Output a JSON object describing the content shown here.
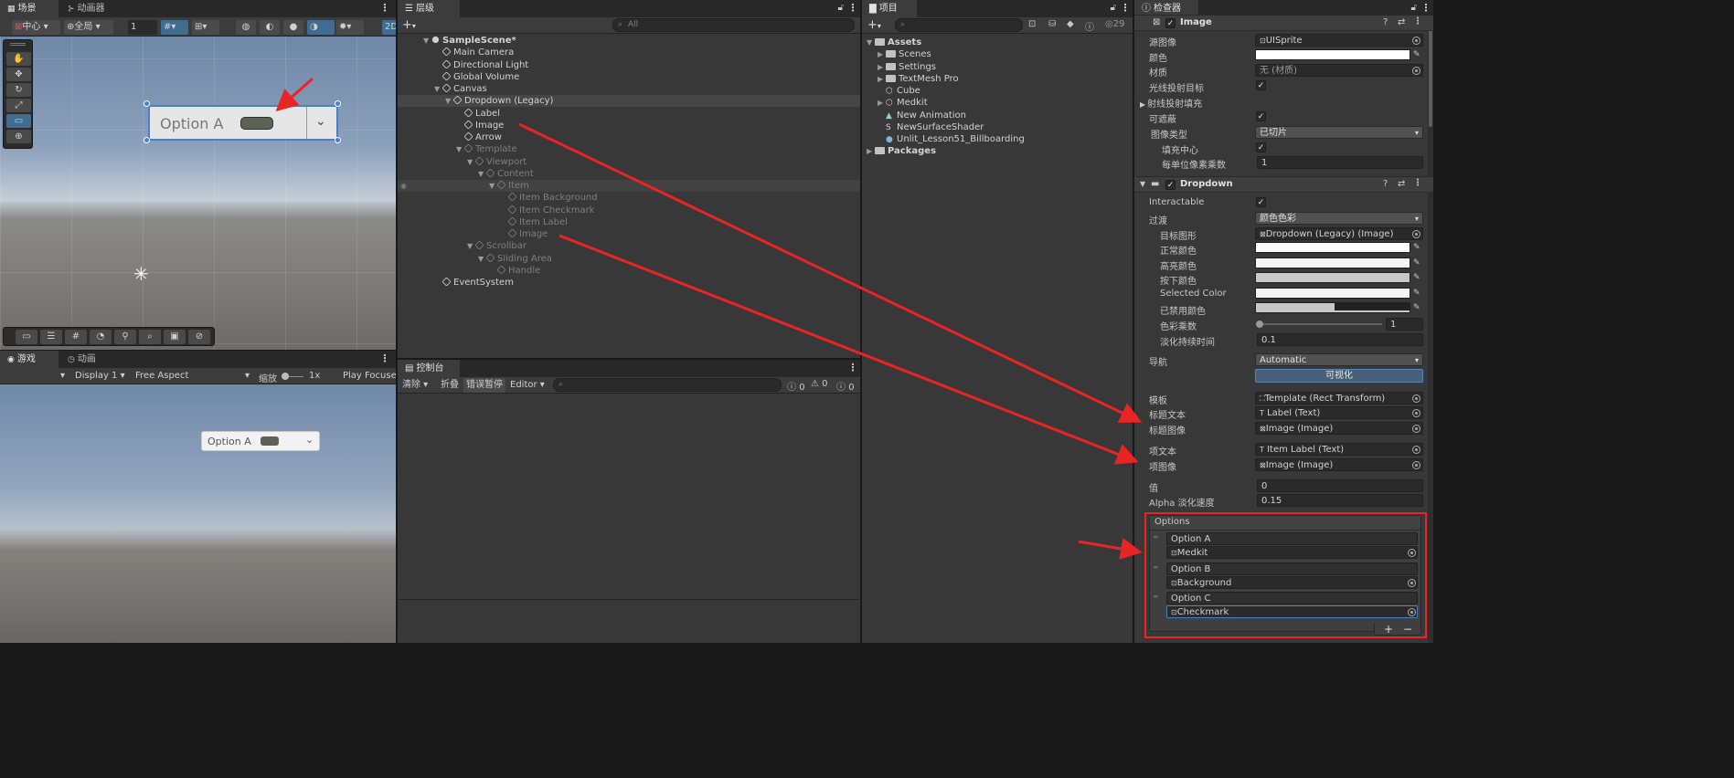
{
  "scene": {
    "tab_label": "场景",
    "tab_animator": "动画器",
    "pivot_label": "中心",
    "space_label": "全局",
    "grid_value": "1",
    "mode_2d": "2D",
    "dropdown_text": "Option A"
  },
  "game": {
    "tab_label": "游戏",
    "tab_animation": "动画",
    "display_label": "Display 1",
    "aspect_label": "Free Aspect",
    "scale_label": "缩放",
    "scale_value": "1x",
    "play_label": "Play Focuse",
    "dropdown_text": "Option A"
  },
  "hierarchy": {
    "tab_label": "层级",
    "search_placeholder": "All",
    "items": [
      {
        "label": "SampleScene*",
        "indent": 0,
        "dim": false,
        "kind": "scene",
        "expand": "open"
      },
      {
        "label": "Main Camera",
        "indent": 1,
        "dim": false,
        "kind": "go",
        "expand": "none"
      },
      {
        "label": "Directional Light",
        "indent": 1,
        "dim": false,
        "kind": "go",
        "expand": "none"
      },
      {
        "label": "Global Volume",
        "indent": 1,
        "dim": false,
        "kind": "go",
        "expand": "none"
      },
      {
        "label": "Canvas",
        "indent": 1,
        "dim": false,
        "kind": "go",
        "expand": "open"
      },
      {
        "label": "Dropdown (Legacy)",
        "indent": 2,
        "dim": false,
        "kind": "go",
        "expand": "open",
        "selected": true
      },
      {
        "label": "Label",
        "indent": 3,
        "dim": false,
        "kind": "go",
        "expand": "none"
      },
      {
        "label": "Image",
        "indent": 3,
        "dim": false,
        "kind": "go",
        "expand": "none"
      },
      {
        "label": "Arrow",
        "indent": 3,
        "dim": false,
        "kind": "go",
        "expand": "none"
      },
      {
        "label": "Template",
        "indent": 3,
        "dim": true,
        "kind": "go",
        "expand": "open"
      },
      {
        "label": "Viewport",
        "indent": 4,
        "dim": true,
        "kind": "go",
        "expand": "open"
      },
      {
        "label": "Content",
        "indent": 5,
        "dim": true,
        "kind": "go",
        "expand": "open"
      },
      {
        "label": "Item",
        "indent": 6,
        "dim": true,
        "kind": "go",
        "expand": "open",
        "hover": true
      },
      {
        "label": "Item Background",
        "indent": 7,
        "dim": true,
        "kind": "go",
        "expand": "none"
      },
      {
        "label": "Item Checkmark",
        "indent": 7,
        "dim": true,
        "kind": "go",
        "expand": "none"
      },
      {
        "label": "Item Label",
        "indent": 7,
        "dim": true,
        "kind": "go",
        "expand": "none"
      },
      {
        "label": "Image",
        "indent": 7,
        "dim": true,
        "kind": "go",
        "expand": "none"
      },
      {
        "label": "Scrollbar",
        "indent": 4,
        "dim": true,
        "kind": "go",
        "expand": "open"
      },
      {
        "label": "Sliding Area",
        "indent": 5,
        "dim": true,
        "kind": "go",
        "expand": "open"
      },
      {
        "label": "Handle",
        "indent": 6,
        "dim": true,
        "kind": "go",
        "expand": "none"
      },
      {
        "label": "EventSystem",
        "indent": 1,
        "dim": false,
        "kind": "go",
        "expand": "none"
      }
    ]
  },
  "console": {
    "tab_label": "控制台",
    "clear_label": "清除",
    "collapse_label": "折叠",
    "errorpause_label": "错误暂停",
    "editor_label": "Editor",
    "log_count": "0",
    "warn_count": "0",
    "error_count": "0"
  },
  "project": {
    "tab_label": "项目",
    "badge_count": "29",
    "items": [
      {
        "label": "Assets",
        "indent": 0,
        "icon": "folder",
        "expand": "open",
        "bold": true
      },
      {
        "label": "Scenes",
        "indent": 1,
        "icon": "folder",
        "expand": "closed"
      },
      {
        "label": "Settings",
        "indent": 1,
        "icon": "folder",
        "expand": "closed"
      },
      {
        "label": "TextMesh Pro",
        "indent": 1,
        "icon": "folder",
        "expand": "closed"
      },
      {
        "label": "Cube",
        "indent": 1,
        "icon": "prefab",
        "expand": "none"
      },
      {
        "label": "Medkit",
        "indent": 1,
        "icon": "prefab",
        "expand": "closed"
      },
      {
        "label": "New Animation",
        "indent": 1,
        "icon": "anim",
        "expand": "none"
      },
      {
        "label": "NewSurfaceShader",
        "indent": 1,
        "icon": "shader",
        "expand": "none"
      },
      {
        "label": "Unlit_Lesson51_Billboarding",
        "indent": 1,
        "icon": "material",
        "expand": "none"
      },
      {
        "label": "Packages",
        "indent": 0,
        "icon": "folder",
        "expand": "closed",
        "bold": true
      }
    ]
  },
  "inspector": {
    "tab_label": "检查器",
    "image": {
      "title": "Image",
      "source_image_label": "源图像",
      "source_image_value": "UISprite",
      "color_label": "颜色",
      "material_label": "材质",
      "material_value": "无 (材质)",
      "raycast_target_label": "光线投射目标",
      "raycast_padding_label": "射线投射填充",
      "maskable_label": "可遮蔽",
      "image_type_label": "图像类型",
      "image_type_value": "已切片",
      "fill_center_label": "填充中心",
      "ppu_label": "每单位像素乘数",
      "ppu_value": "1"
    },
    "dropdown": {
      "title": "Dropdown",
      "interactable_label": "Interactable",
      "transition_label": "过渡",
      "transition_value": "颜色色彩",
      "target_graphic_label": "目标图形",
      "target_graphic_value": "Dropdown (Legacy) (Image)",
      "normal_color_label": "正常颜色",
      "highlighted_color_label": "高亮颜色",
      "pressed_color_label": "按下颜色",
      "selected_color_label": "Selected Color",
      "disabled_color_label": "已禁用颜色",
      "color_multiplier_label": "色彩乘数",
      "color_multiplier_value": "1",
      "fade_duration_label": "淡化持续时间",
      "fade_duration_value": "0.1",
      "navigation_label": "导航",
      "navigation_value": "Automatic",
      "visualize_label": "可视化",
      "template_label": "模板",
      "template_value": "Template (Rect Transform)",
      "caption_text_label": "标题文本",
      "caption_text_value": "Label (Text)",
      "caption_image_label": "标题图像",
      "caption_image_value": "Image (Image)",
      "item_text_label": "项文本",
      "item_text_value": "Item Label (Text)",
      "item_image_label": "项图像",
      "item_image_value": "Image (Image)",
      "value_label": "值",
      "value_value": "0",
      "alpha_fade_label": "Alpha 淡化速度",
      "alpha_fade_value": "0.15",
      "options_header": "Options",
      "options": [
        {
          "text": "Option A",
          "sprite": "Medkit"
        },
        {
          "text": "Option B",
          "sprite": "Background"
        },
        {
          "text": "Option C",
          "sprite": "Checkmark"
        }
      ],
      "add_label": "+",
      "remove_label": "−"
    }
  },
  "colors": {
    "annotation_red": "#e82424",
    "selection_blue": "#2c5d87",
    "panel_bg": "#383838"
  }
}
